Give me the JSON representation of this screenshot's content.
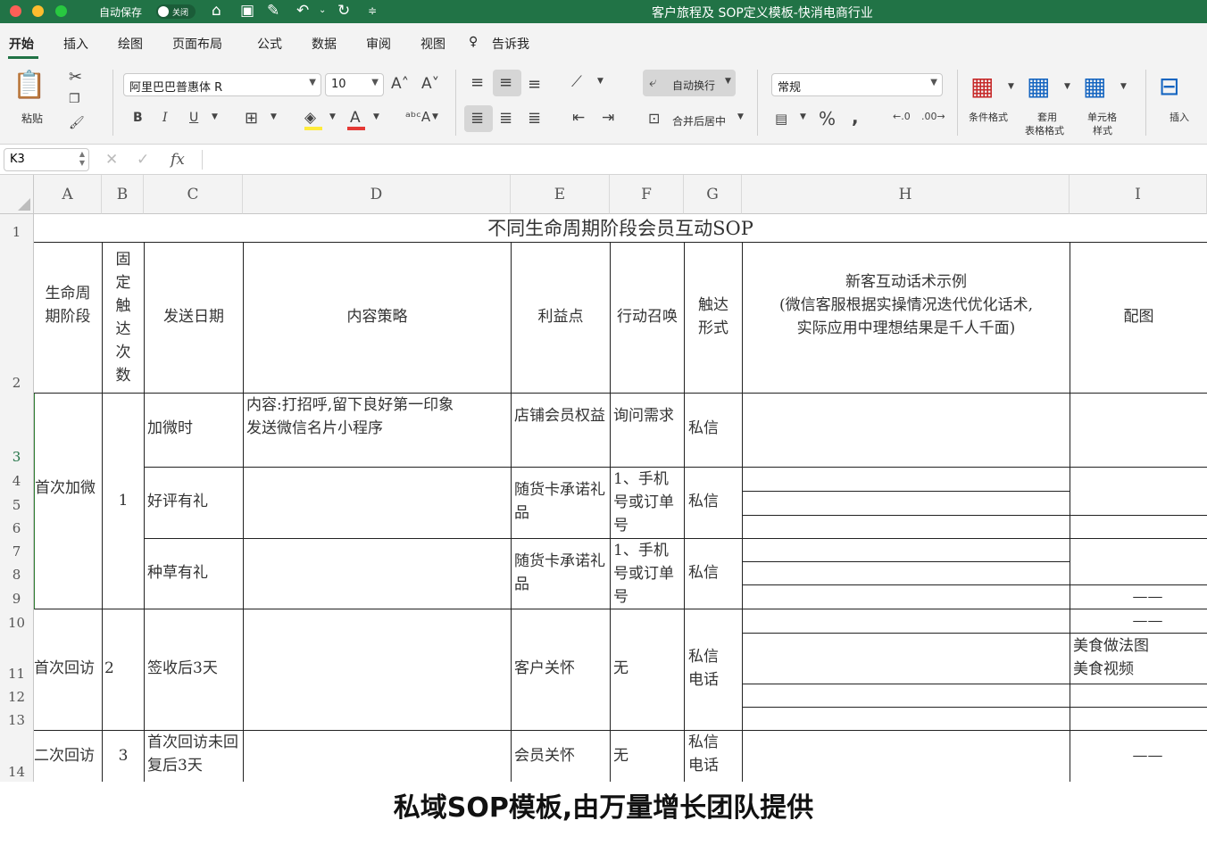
{
  "titlebar": {
    "autosave_label": "自动保存",
    "autosave_state": "关闭",
    "document_title": "客户旅程及 SOP定义模板-快消电商行业"
  },
  "menu": {
    "tabs": [
      "开始",
      "插入",
      "绘图",
      "页面布局",
      "公式",
      "数据",
      "审阅",
      "视图",
      "告诉我"
    ],
    "active_tab": "开始"
  },
  "ribbon": {
    "paste_label": "粘贴",
    "font_name": "阿里巴巴普惠体 R",
    "font_size": "10",
    "bold": "B",
    "italic": "I",
    "underline": "U",
    "wrap_text": "自动换行",
    "merge_center": "合并后居中",
    "number_format": "常规",
    "conditional_format": "条件格式",
    "table_format_line1": "套用",
    "table_format_line2": "表格格式",
    "cell_style_line1": "单元格",
    "cell_style_line2": "样式",
    "insert": "插入"
  },
  "formula_bar": {
    "cell_ref": "K3",
    "fx": "fx",
    "content": ""
  },
  "sheet": {
    "columns": [
      "A",
      "B",
      "C",
      "D",
      "E",
      "F",
      "G",
      "H",
      "I"
    ],
    "rows": [
      "1",
      "2",
      "3",
      "4",
      "5",
      "6",
      "7",
      "8",
      "9",
      "10",
      "11",
      "12",
      "13",
      "14"
    ],
    "selected_row": "3",
    "title": "不同生命周期阶段会员互动SOP",
    "headers": {
      "stage": "生命周期阶段",
      "count": "固定触达次数",
      "date": "发送日期",
      "content": "内容策略",
      "benefit": "利益点",
      "cta": "行动召唤",
      "channel": "触达形式",
      "script_title": "新客互动话术示例",
      "script_note1": "(微信客服根据实操情况迭代优化话术,",
      "script_note2": "实际应用中理想结果是千人千面)",
      "image": "配图"
    },
    "groups": [
      {
        "stage": "首次加微",
        "count": "1",
        "entries": [
          {
            "date": "加微时",
            "content": "内容:打招呼,留下良好第一印象\n发送微信名片小程序",
            "benefit": "店铺会员权益",
            "cta": "询问需求",
            "channel": "私信",
            "image": ""
          },
          {
            "date": "好评有礼",
            "content": "",
            "benefit": "随货卡承诺礼品",
            "cta": "1、手机号或订单号",
            "channel": "私信",
            "image": ""
          },
          {
            "date": "种草有礼",
            "content": "",
            "benefit": "随货卡承诺礼品",
            "cta": "1、手机号或订单号",
            "channel": "私信",
            "image": "——"
          }
        ]
      },
      {
        "stage": "首次回访",
        "count": "2",
        "entries": [
          {
            "date": "签收后3天",
            "content": "",
            "benefit": "客户关怀",
            "cta": "无",
            "channel": "私信\n电话",
            "image_top": "——",
            "image": "美食做法图\n美食视频"
          }
        ]
      },
      {
        "stage": "二次回访",
        "count": "3",
        "entries": [
          {
            "date": "首次回访未回复后3天",
            "content": "",
            "benefit": "会员关怀",
            "cta": "无",
            "channel": "私信\n电话",
            "image": "——"
          }
        ]
      }
    ]
  },
  "caption": "私域SOP模板,由万量增长团队提供"
}
